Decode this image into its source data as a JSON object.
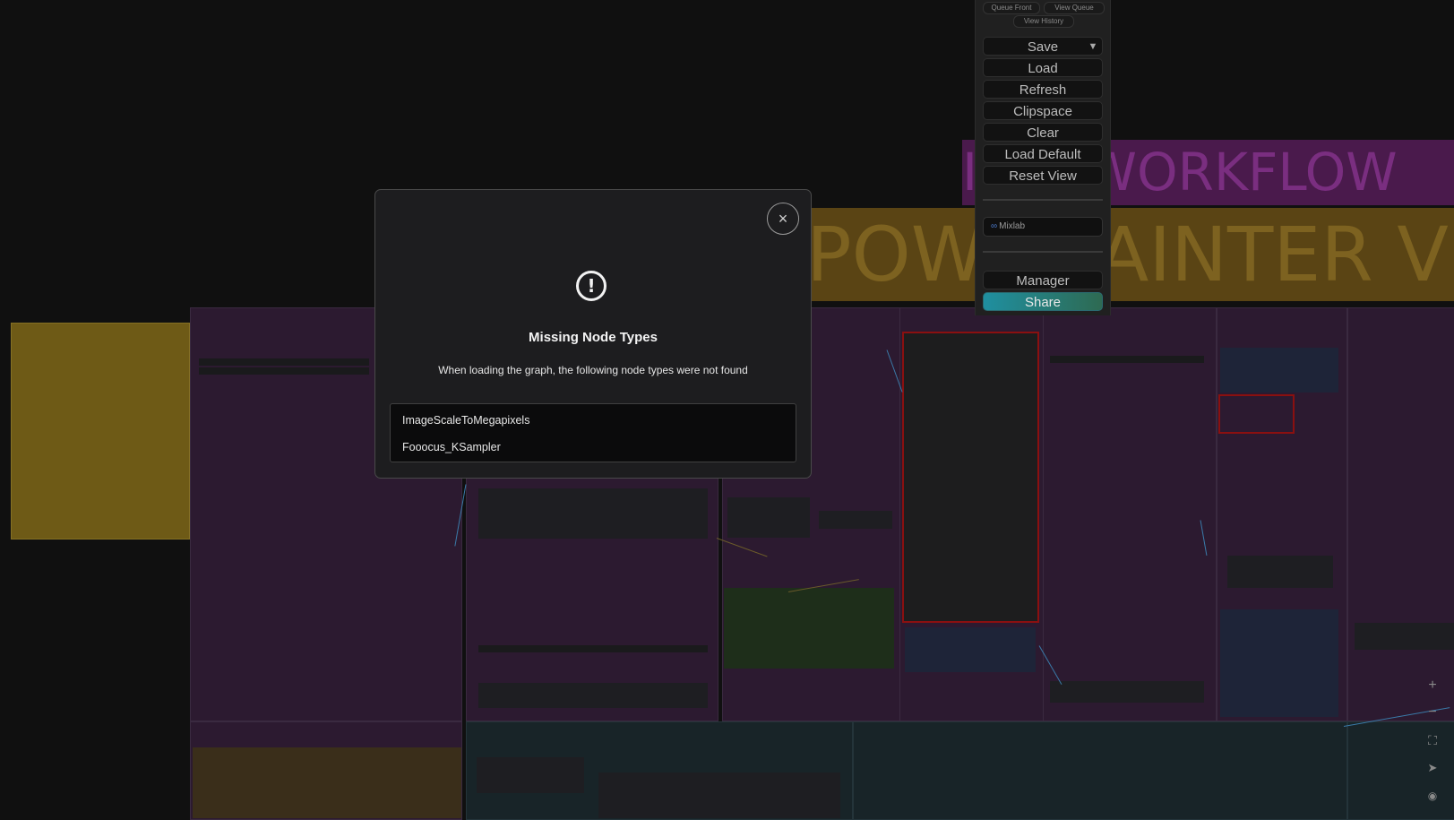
{
  "canvas": {
    "banner_top_text": "I     OK WORKFLOW",
    "banner_mid_text": "POWE     PAINTER V"
  },
  "menu": {
    "queue_front_label": "Queue Front",
    "view_queue_label": "View Queue",
    "view_history_label": "View History",
    "buttons": [
      {
        "label": "Save"
      },
      {
        "label": "Load"
      },
      {
        "label": "Refresh"
      },
      {
        "label": "Clipspace"
      },
      {
        "label": "Clear"
      },
      {
        "label": "Load Default"
      },
      {
        "label": "Reset View"
      }
    ],
    "save_dropdown_glyph": "▼",
    "mixlab_label": "Mixlab",
    "manager_label": "Manager",
    "share_label": "Share"
  },
  "canvas_controls": {
    "zoom_in_glyph": "+",
    "zoom_out_glyph": "−",
    "fit_glyph": "⛶",
    "send_glyph": "➤",
    "eye_glyph": "◉"
  },
  "dialog": {
    "close_glyph": "×",
    "icon_glyph": "!",
    "title": "Missing Node Types",
    "message": "When loading the graph, the following node types were not found",
    "missing_nodes": [
      "ImageScaleToMegapixels",
      "Fooocus_KSampler"
    ]
  }
}
